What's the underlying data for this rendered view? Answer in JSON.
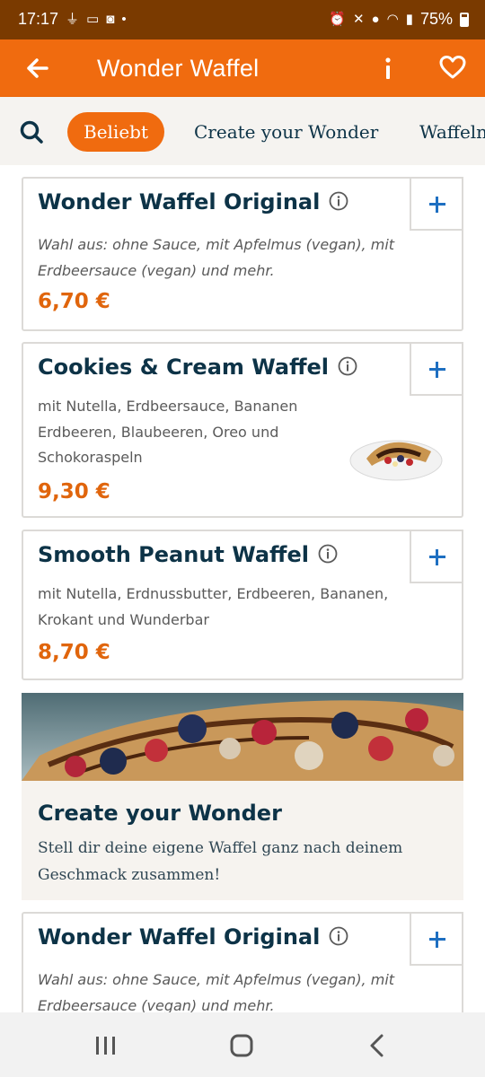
{
  "status_bar": {
    "time": "17:17",
    "battery": "75%"
  },
  "app_bar": {
    "title": "Wonder Waffel"
  },
  "tabs": [
    {
      "label": "Beliebt"
    },
    {
      "label": "Create your Wonder"
    },
    {
      "label": "Waffeln"
    }
  ],
  "products": [
    {
      "name": "Wonder Waffel Original",
      "description": "Wahl aus: ohne Sauce, mit Apfelmus (vegan), mit Erdbeersauce (vegan) und mehr.",
      "price": "6,70 €"
    },
    {
      "name": "Cookies & Cream Waffel",
      "description": "mit Nutella, Erdbeersauce, Bananen Erdbeeren, Blaubeeren, Oreo und Schokoraspeln",
      "price": "9,30 €"
    },
    {
      "name": "Smooth Peanut Waffel",
      "description": "mit Nutella, Erdnussbutter, Erdbeeren, Bananen, Krokant und Wunderbar",
      "price": "8,70 €"
    },
    {
      "name": "Wonder Waffel Original",
      "description": "Wahl aus: ohne Sauce, mit Apfelmus (vegan), mit Erdbeersauce (vegan) und mehr.",
      "price": ""
    }
  ],
  "promo": {
    "title": "Create your Wonder",
    "text": "Stell dir deine eigene Waffel ganz nach deinem Geschmack zusammen!"
  },
  "icons": {
    "back": "arrow-left-icon",
    "info": "info-icon",
    "favorite": "heart-icon",
    "search": "search-icon",
    "add": "plus-icon",
    "product_info": "info-circle-icon",
    "recents": "recents-icon",
    "home": "home-icon",
    "nav_back": "chevron-left-icon"
  },
  "colors": {
    "status_bar": "#7a3a00",
    "brand_orange": "#f06b0f",
    "price_orange": "#e0650c",
    "heading_navy": "#0d3347",
    "plus_blue": "#1e6fc1"
  }
}
